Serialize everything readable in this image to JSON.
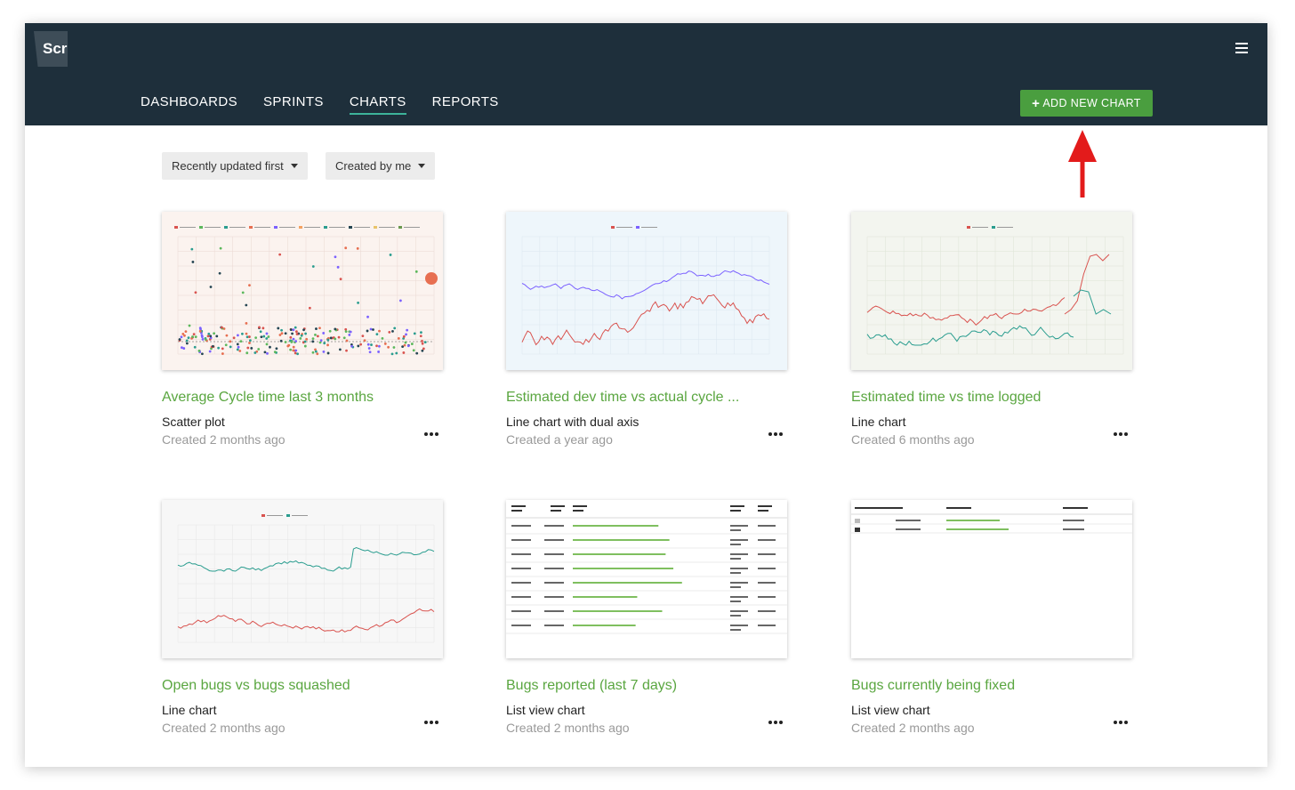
{
  "app": {
    "logo_text": "Scr"
  },
  "nav": {
    "items": [
      "DASHBOARDS",
      "SPRINTS",
      "CHARTS",
      "REPORTS"
    ],
    "active": "CHARTS"
  },
  "add_chart_button": {
    "label": "ADD NEW CHART",
    "icon": "plus-icon"
  },
  "filters": {
    "sort": "Recently updated first",
    "owner": "Created by me"
  },
  "colors": {
    "topbar": "#1e2f3b",
    "accent_green": "#4a9e3f",
    "title_green": "#5aa640",
    "active_underline": "#3db39a",
    "arrow_red": "#e31b1b"
  },
  "cards": [
    {
      "title": "Average Cycle time last 3 months",
      "type": "Scatter plot",
      "created": "Created 2 months ago",
      "thumbnail": "scatter"
    },
    {
      "title": "Estimated dev time vs actual cycle ...",
      "type": "Line chart with dual axis",
      "created": "Created a year ago",
      "thumbnail": "dual-line"
    },
    {
      "title": "Estimated time vs time logged",
      "type": "Line chart",
      "created": "Created 6 months ago",
      "thumbnail": "line"
    },
    {
      "title": "Open bugs vs bugs squashed",
      "type": "Line chart",
      "created": "Created 2 months ago",
      "thumbnail": "line"
    },
    {
      "title": "Bugs reported (last 7 days)",
      "type": "List view chart",
      "created": "Created 2 months ago",
      "thumbnail": "table"
    },
    {
      "title": "Bugs currently being fixed",
      "type": "List view chart",
      "created": "Created 2 months ago",
      "thumbnail": "table"
    }
  ]
}
